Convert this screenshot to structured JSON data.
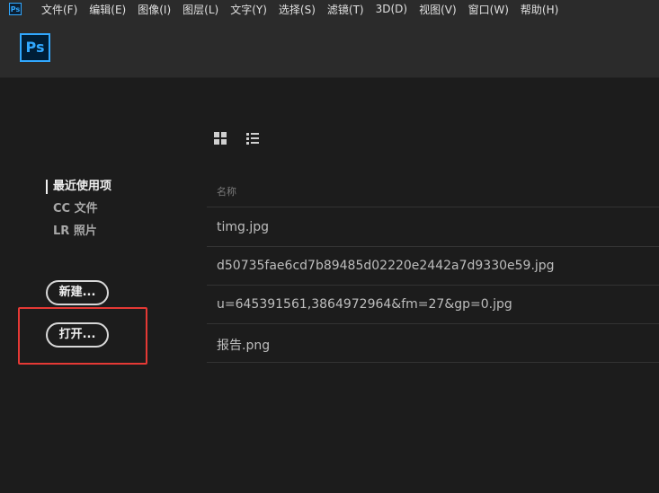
{
  "menubar": {
    "logo": "Ps",
    "items": [
      "文件(F)",
      "编辑(E)",
      "图像(I)",
      "图层(L)",
      "文字(Y)",
      "选择(S)",
      "滤镜(T)",
      "3D(D)",
      "视图(V)",
      "窗口(W)",
      "帮助(H)"
    ]
  },
  "header": {
    "logo": "Ps"
  },
  "nav": {
    "recent": "最近使用项",
    "cc_files": "CC 文件",
    "lr_photos": "LR 照片"
  },
  "buttons": {
    "new": "新建...",
    "open": "打开..."
  },
  "files": {
    "column_header": "名称",
    "rows": [
      "timg.jpg",
      "d50735fae6cd7b89485d02220e2442a7d9330e59.jpg",
      "u=645391561,3864972964&fm=27&gp=0.jpg",
      "报告.png"
    ]
  },
  "colors": {
    "accent": "#31a8ff",
    "highlight": "#e53935"
  }
}
